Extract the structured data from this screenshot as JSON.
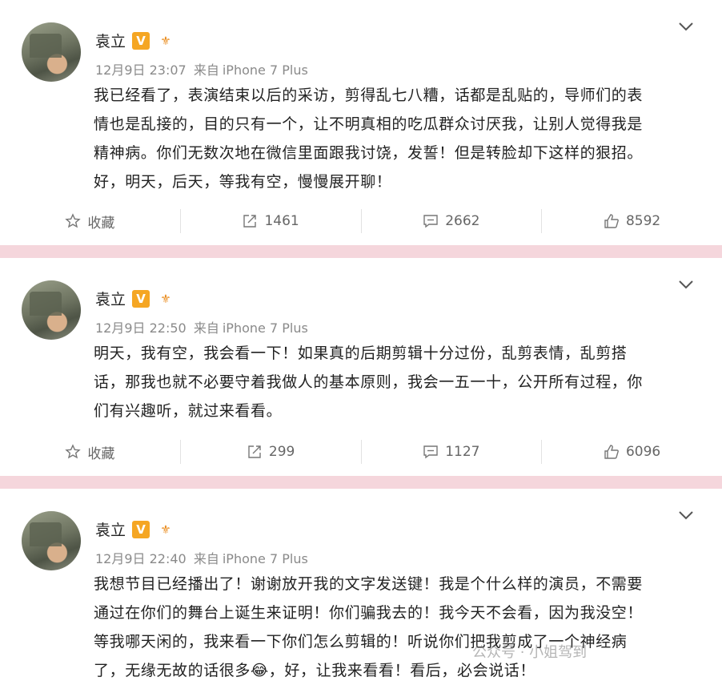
{
  "posts": [
    {
      "author": "袁立",
      "verified": "V",
      "level": "⚜",
      "time": "12月9日 23:07",
      "source_prefix": "来自",
      "source": "iPhone 7 Plus",
      "lines": [
        "我已经看了，表演结束以后的采访，剪得乱七八糟，话都是乱贴的，导师们的表",
        "情也是乱接的，目的只有一个，让不明真相的吃瓜群众讨厌我，让别人觉得我是",
        "精神病。你们无数次地在微信里面跟我讨饶，发誓！但是转脸却下这样的狠招。",
        "好，明天，后天，等我有空，慢慢展开聊！"
      ],
      "actions": {
        "favorite": "收藏",
        "reposts": "1461",
        "comments": "2662",
        "likes": "8592"
      }
    },
    {
      "author": "袁立",
      "verified": "V",
      "level": "⚜",
      "time": "12月9日 22:50",
      "source_prefix": "来自",
      "source": "iPhone 7 Plus",
      "lines": [
        "明天，我有空，我会看一下！如果真的后期剪辑十分过份，乱剪表情，乱剪搭",
        "话，那我也就不必要守着我做人的基本原则，我会一五一十，公开所有过程，你",
        "们有兴趣听，就过来看看。"
      ],
      "actions": {
        "favorite": "收藏",
        "reposts": "299",
        "comments": "1127",
        "likes": "6096"
      }
    },
    {
      "author": "袁立",
      "verified": "V",
      "level": "⚜",
      "time": "12月9日 22:40",
      "source_prefix": "来自",
      "source": "iPhone 7 Plus",
      "lines": [
        "我想节目已经播出了！谢谢放开我的文字发送键！我是个什么样的演员，不需要",
        "通过在你们的舞台上诞生来证明！你们骗我去的！我今天不会看，因为我没空！",
        "等我哪天闲的，我来看一下你们怎么剪辑的！听说你们把我剪成了一个神经病",
        "了，无缘无故的话很多😂，好，让我来看看！看后，必会说话！"
      ]
    }
  ],
  "watermark": "公众号 · 小姐驾到",
  "colors": {
    "divider": "#f5d6dc",
    "badge": "#f5a623",
    "meta": "#8a8a8a"
  }
}
